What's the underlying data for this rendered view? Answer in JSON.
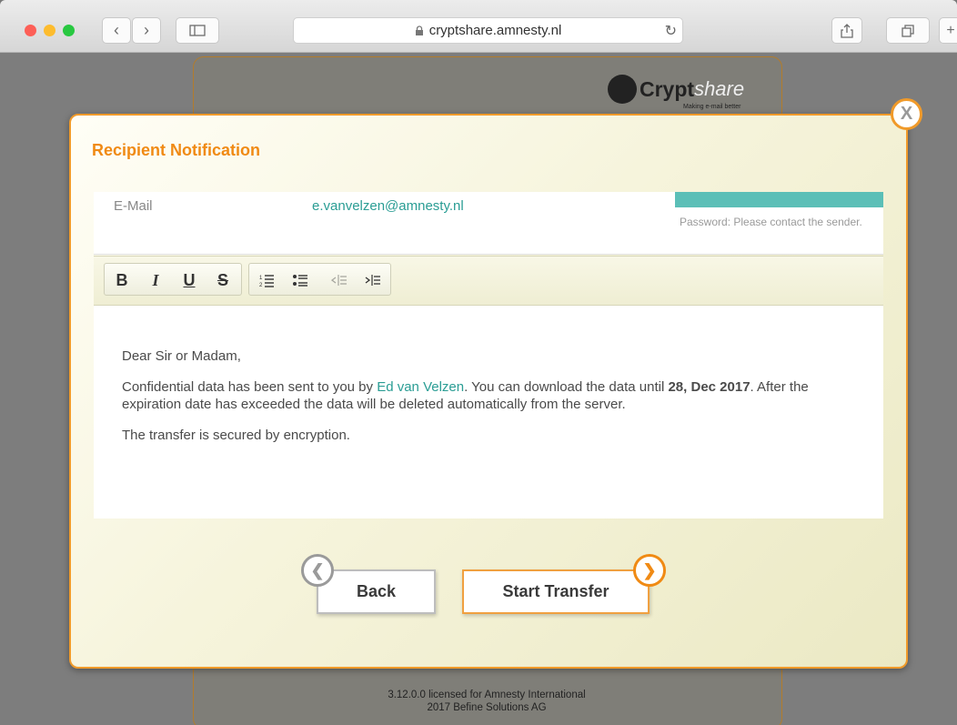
{
  "browser": {
    "url": "cryptshare.amnesty.nl",
    "colors": {
      "close": "#fd5f57",
      "minimize": "#fdbc2e",
      "zoom": "#28c840"
    }
  },
  "background": {
    "logo_text_bold": "Crypt",
    "logo_text_light": "share",
    "logo_tagline": "Making e-mail better",
    "footer_line1": "3.12.0.0 licensed for Amnesty International",
    "footer_line2": "2017 Befine Solutions AG"
  },
  "modal": {
    "title": "Recipient Notification",
    "close_label": "X",
    "email_label": "E-Mail",
    "email_value": "e.vanvelzen@amnesty.nl",
    "password_note": "Password: Please contact the sender.",
    "toolbar": {
      "bold": "B",
      "italic": "I",
      "underline": "U",
      "strike": "S"
    },
    "message": {
      "greeting": "Dear Sir or Madam,",
      "line1_a": "Confidential data has been sent to you by ",
      "sender": "Ed van Velzen",
      "line1_b": ". You can download the data until ",
      "expiry": "28, Dec 2017",
      "line1_c": ". After the expiration date has exceeded the data will be deleted automatically from the server.",
      "line2": "The transfer is secured by encryption."
    },
    "back_label": "Back",
    "start_label": "Start Transfer",
    "accent_color": "#f08a14",
    "link_color": "#2a9d94"
  }
}
